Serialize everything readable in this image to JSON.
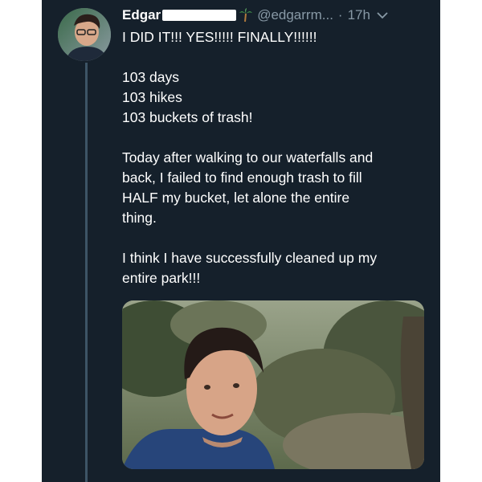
{
  "tweet": {
    "author_name": "Edgar",
    "handle": "@edgarrm...",
    "separator": "·",
    "time": "17h",
    "verified_emoji_icon": "palm-tree-icon",
    "menu_icon": "chevron-down-icon",
    "lines_block1": [
      "I DID IT!!! YES!!!!! FINALLY!!!!!!"
    ],
    "lines_block2": [
      "103 days",
      "103 hikes",
      "103 buckets of trash!"
    ],
    "lines_block3": [
      "Today after walking to our waterfalls and",
      "back, I failed to find enough trash to fill",
      "HALF my bucket, let alone the entire",
      "thing."
    ],
    "lines_block4": [
      "I think I have successfully cleaned up my",
      "entire park!!!"
    ]
  },
  "colors": {
    "background": "#15202b",
    "text_primary": "#ffffff",
    "text_secondary": "#8899a6",
    "thread_line": "#3d5466"
  }
}
